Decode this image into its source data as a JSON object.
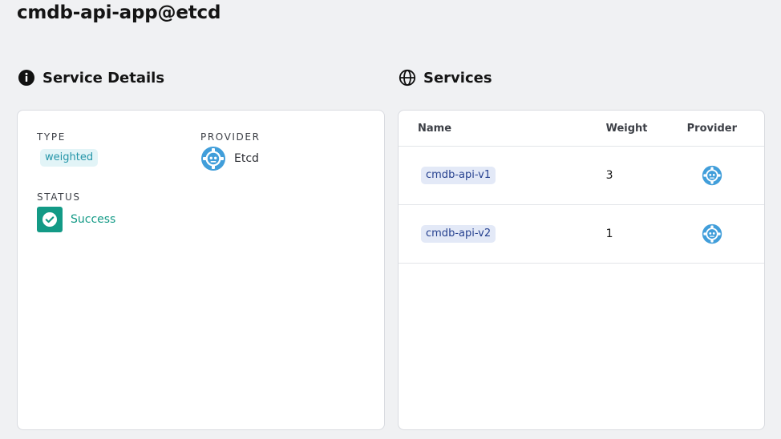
{
  "page": {
    "title": "cmdb-api-app@etcd"
  },
  "service_details": {
    "title": "Service Details",
    "type_label": "TYPE",
    "type_value": "weighted",
    "provider_label": "PROVIDER",
    "provider_value": "Etcd",
    "status_label": "STATUS",
    "status_value": "Success"
  },
  "services": {
    "title": "Services",
    "columns": [
      "Name",
      "Weight",
      "Provider"
    ],
    "rows": [
      {
        "name": "cmdb-api-v1",
        "weight": "3",
        "provider_icon": "etcd-icon"
      },
      {
        "name": "cmdb-api-v2",
        "weight": "1",
        "provider_icon": "etcd-icon"
      }
    ]
  },
  "colors": {
    "background": "#f0f1f3",
    "success": "#139a86",
    "etcd_blue": "#419eda",
    "chip_blue_text": "#25408f"
  }
}
